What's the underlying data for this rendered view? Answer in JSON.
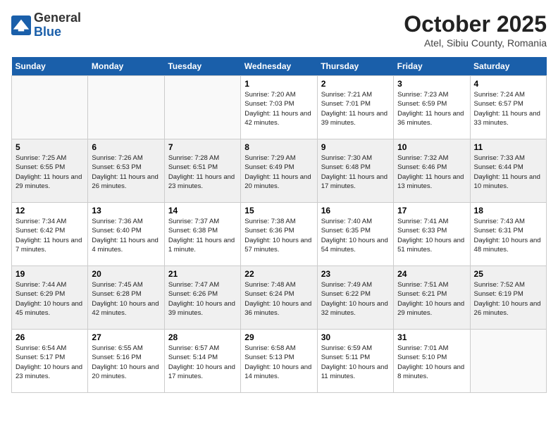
{
  "header": {
    "logo_general": "General",
    "logo_blue": "Blue",
    "title": "October 2025",
    "subtitle": "Atel, Sibiu County, Romania"
  },
  "days_of_week": [
    "Sunday",
    "Monday",
    "Tuesday",
    "Wednesday",
    "Thursday",
    "Friday",
    "Saturday"
  ],
  "weeks": [
    [
      {
        "num": "",
        "info": ""
      },
      {
        "num": "",
        "info": ""
      },
      {
        "num": "",
        "info": ""
      },
      {
        "num": "1",
        "info": "Sunrise: 7:20 AM\nSunset: 7:03 PM\nDaylight: 11 hours and 42 minutes."
      },
      {
        "num": "2",
        "info": "Sunrise: 7:21 AM\nSunset: 7:01 PM\nDaylight: 11 hours and 39 minutes."
      },
      {
        "num": "3",
        "info": "Sunrise: 7:23 AM\nSunset: 6:59 PM\nDaylight: 11 hours and 36 minutes."
      },
      {
        "num": "4",
        "info": "Sunrise: 7:24 AM\nSunset: 6:57 PM\nDaylight: 11 hours and 33 minutes."
      }
    ],
    [
      {
        "num": "5",
        "info": "Sunrise: 7:25 AM\nSunset: 6:55 PM\nDaylight: 11 hours and 29 minutes."
      },
      {
        "num": "6",
        "info": "Sunrise: 7:26 AM\nSunset: 6:53 PM\nDaylight: 11 hours and 26 minutes."
      },
      {
        "num": "7",
        "info": "Sunrise: 7:28 AM\nSunset: 6:51 PM\nDaylight: 11 hours and 23 minutes."
      },
      {
        "num": "8",
        "info": "Sunrise: 7:29 AM\nSunset: 6:49 PM\nDaylight: 11 hours and 20 minutes."
      },
      {
        "num": "9",
        "info": "Sunrise: 7:30 AM\nSunset: 6:48 PM\nDaylight: 11 hours and 17 minutes."
      },
      {
        "num": "10",
        "info": "Sunrise: 7:32 AM\nSunset: 6:46 PM\nDaylight: 11 hours and 13 minutes."
      },
      {
        "num": "11",
        "info": "Sunrise: 7:33 AM\nSunset: 6:44 PM\nDaylight: 11 hours and 10 minutes."
      }
    ],
    [
      {
        "num": "12",
        "info": "Sunrise: 7:34 AM\nSunset: 6:42 PM\nDaylight: 11 hours and 7 minutes."
      },
      {
        "num": "13",
        "info": "Sunrise: 7:36 AM\nSunset: 6:40 PM\nDaylight: 11 hours and 4 minutes."
      },
      {
        "num": "14",
        "info": "Sunrise: 7:37 AM\nSunset: 6:38 PM\nDaylight: 11 hours and 1 minute."
      },
      {
        "num": "15",
        "info": "Sunrise: 7:38 AM\nSunset: 6:36 PM\nDaylight: 10 hours and 57 minutes."
      },
      {
        "num": "16",
        "info": "Sunrise: 7:40 AM\nSunset: 6:35 PM\nDaylight: 10 hours and 54 minutes."
      },
      {
        "num": "17",
        "info": "Sunrise: 7:41 AM\nSunset: 6:33 PM\nDaylight: 10 hours and 51 minutes."
      },
      {
        "num": "18",
        "info": "Sunrise: 7:43 AM\nSunset: 6:31 PM\nDaylight: 10 hours and 48 minutes."
      }
    ],
    [
      {
        "num": "19",
        "info": "Sunrise: 7:44 AM\nSunset: 6:29 PM\nDaylight: 10 hours and 45 minutes."
      },
      {
        "num": "20",
        "info": "Sunrise: 7:45 AM\nSunset: 6:28 PM\nDaylight: 10 hours and 42 minutes."
      },
      {
        "num": "21",
        "info": "Sunrise: 7:47 AM\nSunset: 6:26 PM\nDaylight: 10 hours and 39 minutes."
      },
      {
        "num": "22",
        "info": "Sunrise: 7:48 AM\nSunset: 6:24 PM\nDaylight: 10 hours and 36 minutes."
      },
      {
        "num": "23",
        "info": "Sunrise: 7:49 AM\nSunset: 6:22 PM\nDaylight: 10 hours and 32 minutes."
      },
      {
        "num": "24",
        "info": "Sunrise: 7:51 AM\nSunset: 6:21 PM\nDaylight: 10 hours and 29 minutes."
      },
      {
        "num": "25",
        "info": "Sunrise: 7:52 AM\nSunset: 6:19 PM\nDaylight: 10 hours and 26 minutes."
      }
    ],
    [
      {
        "num": "26",
        "info": "Sunrise: 6:54 AM\nSunset: 5:17 PM\nDaylight: 10 hours and 23 minutes."
      },
      {
        "num": "27",
        "info": "Sunrise: 6:55 AM\nSunset: 5:16 PM\nDaylight: 10 hours and 20 minutes."
      },
      {
        "num": "28",
        "info": "Sunrise: 6:57 AM\nSunset: 5:14 PM\nDaylight: 10 hours and 17 minutes."
      },
      {
        "num": "29",
        "info": "Sunrise: 6:58 AM\nSunset: 5:13 PM\nDaylight: 10 hours and 14 minutes."
      },
      {
        "num": "30",
        "info": "Sunrise: 6:59 AM\nSunset: 5:11 PM\nDaylight: 10 hours and 11 minutes."
      },
      {
        "num": "31",
        "info": "Sunrise: 7:01 AM\nSunset: 5:10 PM\nDaylight: 10 hours and 8 minutes."
      },
      {
        "num": "",
        "info": ""
      }
    ]
  ]
}
